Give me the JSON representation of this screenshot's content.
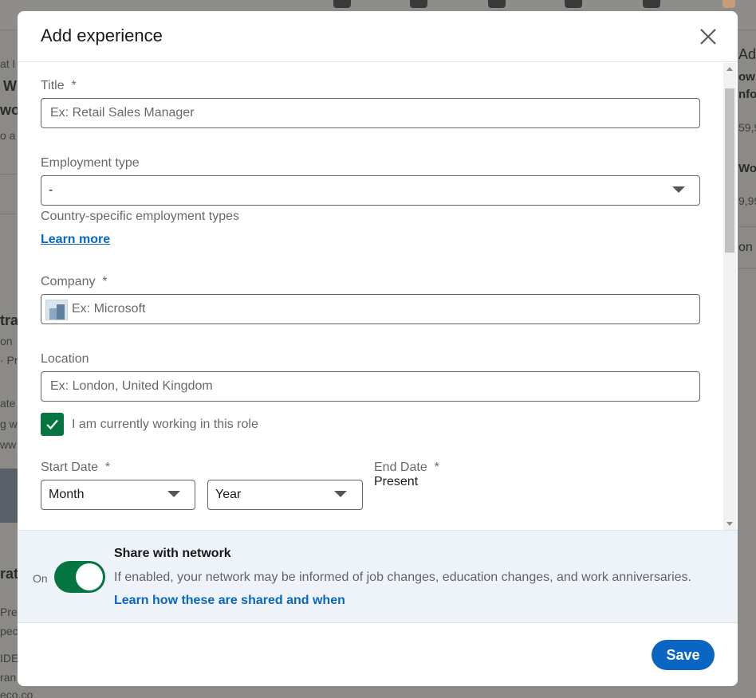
{
  "background": {
    "left_fragments": [
      "at l",
      "W",
      "wo",
      "o a",
      "tra",
      "on",
      "· Pr",
      "ate",
      "g w",
      "ww",
      "rate",
      "Pre",
      "pec",
      "IDE",
      "ran",
      "eco.co"
    ],
    "right_fragments": [
      "Add",
      "ow",
      "nfo",
      "59,9",
      "Wor",
      "9,99",
      "on"
    ]
  },
  "modal": {
    "title": "Add experience",
    "close_label": "Dismiss",
    "fields": {
      "title": {
        "label": "Title",
        "required_mark": "*",
        "placeholder": "Ex: Retail Sales Manager"
      },
      "employment_type": {
        "label": "Employment type",
        "value": "-",
        "help_text": "Country-specific employment types",
        "learn_more": "Learn more"
      },
      "company": {
        "label": "Company",
        "required_mark": "*",
        "placeholder": "Ex: Microsoft"
      },
      "location": {
        "label": "Location",
        "placeholder": "Ex: London, United Kingdom"
      },
      "currently_working": {
        "label": "I am currently working in this role",
        "checked": true
      },
      "start_date": {
        "label": "Start Date",
        "required_mark": "*",
        "month": "Month",
        "year": "Year"
      },
      "end_date": {
        "label": "End Date",
        "required_mark": "*",
        "value": "Present"
      }
    },
    "share": {
      "state_label": "On",
      "enabled": true,
      "title": "Share with network",
      "description": "If enabled, your network may be informed of job changes, education changes, and work anniversaries.",
      "link": "Learn how these are shared and when"
    },
    "save_label": "Save"
  },
  "colors": {
    "brand_blue": "#0a66c2",
    "accent_green": "#057642",
    "overlay": "#8c8a87"
  },
  "icons": {
    "close": "close-icon",
    "caret": "caret-down-icon",
    "check": "check-icon",
    "company_logo": "company-placeholder-logo"
  }
}
